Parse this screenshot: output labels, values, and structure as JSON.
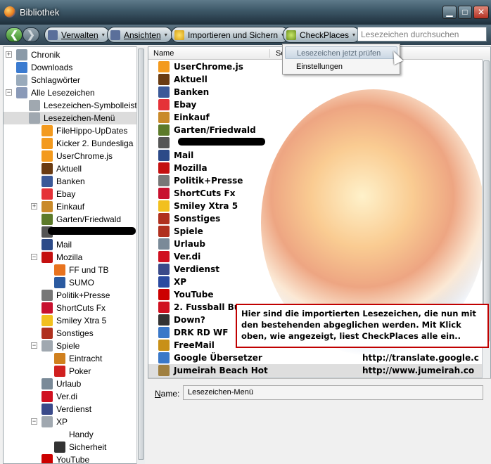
{
  "window": {
    "title": "Bibliothek",
    "minimize": "▁",
    "maximize": "□",
    "close": "✕"
  },
  "toolbar": {
    "back_glyph": "❮",
    "forward_glyph": "❯",
    "verwalten": "Verwalten",
    "ansichten": "Ansichten",
    "importieren": "Importieren und Sichern",
    "checkplaces": "CheckPlaces",
    "dropdown_glyph": "▾",
    "search_placeholder": "Lesezeichen durchsuchen"
  },
  "dropdown": {
    "items": [
      "Lesezeichen jetzt prüfen",
      "Einstellungen"
    ]
  },
  "tree": [
    {
      "label": "Chronik",
      "icon": "clock-icon",
      "color": "#8a9aa8"
    },
    {
      "label": "Downloads",
      "icon": "download-arrow-icon",
      "color": "#3b7bd0"
    },
    {
      "label": "Schlagwörter",
      "icon": "tag-icon",
      "color": "#9ab"
    },
    {
      "label": "Alle Lesezeichen",
      "icon": "bookmark-star-icon",
      "color": "#8a9ab8"
    },
    {
      "label": "Lesezeichen-Symbolleiste",
      "icon": "toolbar-folder-icon",
      "color": "#a0a8b0"
    },
    {
      "label": "Lesezeichen-Menü",
      "icon": "menu-folder-icon",
      "color": "#a0a8b0"
    },
    {
      "label": "FileHippo-UpDates",
      "icon": "rss-feed-icon",
      "color": "#f39a1e"
    },
    {
      "label": "Kicker 2. Bundesliga",
      "icon": "rss-feed-icon",
      "color": "#f39a1e"
    },
    {
      "label": "UserChrome.js",
      "icon": "rss-feed-icon",
      "color": "#f39a1e"
    },
    {
      "label": "Aktuell",
      "icon": "torch-icon",
      "color": "#6a3b12"
    },
    {
      "label": "Banken",
      "icon": "facebook-icon",
      "color": "#3b5998"
    },
    {
      "label": "Ebay",
      "icon": "ebay-icon",
      "color": "#e53238"
    },
    {
      "label": "Einkauf",
      "icon": "coin-icon",
      "color": "#c98a2a"
    },
    {
      "label": "Garten/Friedwald",
      "icon": "tree-icon",
      "color": "#5c7a2a"
    },
    {
      "label": "",
      "icon": "anonymous-icon",
      "color": "#555"
    },
    {
      "label": "Mail",
      "icon": "mail-icon",
      "color": "#2c4a88"
    },
    {
      "label": "Mozilla",
      "icon": "mozilla-icon",
      "color": "#c41010"
    },
    {
      "label": "FF und TB",
      "icon": "firefox-icon",
      "color": "#e8731f"
    },
    {
      "label": "SUMO",
      "icon": "sumo-icon",
      "color": "#2b5aa0"
    },
    {
      "label": "Politik+Presse",
      "icon": "newspaper-icon",
      "color": "#777"
    },
    {
      "label": "ShortCuts Fx",
      "icon": "flag-icon",
      "color": "#c8102e"
    },
    {
      "label": "Smiley Xtra 5",
      "icon": "smiley-icon",
      "color": "#f2c01e"
    },
    {
      "label": "Sonstiges",
      "icon": "gift-icon",
      "color": "#b0301e"
    },
    {
      "label": "Spiele",
      "icon": "game-folder-icon",
      "color": "#a0a8b0"
    },
    {
      "label": "Eintracht",
      "icon": "diamond-icon",
      "color": "#d0801e"
    },
    {
      "label": "Poker",
      "icon": "poker-icon",
      "color": "#d02020"
    },
    {
      "label": "Urlaub",
      "icon": "plane-icon",
      "color": "#7a8a98"
    },
    {
      "label": "Ver.di",
      "icon": "verdi-icon",
      "color": "#d01020"
    },
    {
      "label": "Verdienst",
      "icon": "money-icon",
      "color": "#3a4a8a"
    },
    {
      "label": "XP",
      "icon": "xp-folder-icon",
      "color": "#a0a8b0"
    },
    {
      "label": "Handy",
      "icon": "phone-icon",
      "color": "#fff"
    },
    {
      "label": "Sicherheit",
      "icon": "security-icon",
      "color": "#333"
    },
    {
      "label": "YouTube",
      "icon": "youtube-icon",
      "color": "#c00"
    }
  ],
  "columns": {
    "name": "Name",
    "location": "So"
  },
  "list": [
    {
      "label": "UserChrome.js",
      "icon": "rss-feed-icon",
      "color": "#f39a1e",
      "url": ""
    },
    {
      "label": "Aktuell",
      "icon": "torch-icon",
      "color": "#6a3b12",
      "url": ""
    },
    {
      "label": "Banken",
      "icon": "facebook-icon",
      "color": "#3b5998",
      "url": ""
    },
    {
      "label": "Ebay",
      "icon": "ebay-icon",
      "color": "#e53238",
      "url": ""
    },
    {
      "label": "Einkauf",
      "icon": "coin-icon",
      "color": "#c98a2a",
      "url": ""
    },
    {
      "label": "Garten/Friedwald",
      "icon": "tree-icon",
      "color": "#5c7a2a",
      "url": ""
    },
    {
      "label": "",
      "icon": "anonymous-icon",
      "color": "#555",
      "url": ""
    },
    {
      "label": "Mail",
      "icon": "mail-icon",
      "color": "#2c4a88",
      "url": ""
    },
    {
      "label": "Mozilla",
      "icon": "mozilla-icon",
      "color": "#c41010",
      "url": ""
    },
    {
      "label": "Politik+Presse",
      "icon": "newspaper-icon",
      "color": "#777",
      "url": ""
    },
    {
      "label": "ShortCuts Fx",
      "icon": "flag-icon",
      "color": "#c8102e",
      "url": ""
    },
    {
      "label": "Smiley Xtra 5",
      "icon": "smiley-icon",
      "color": "#f2c01e",
      "url": ""
    },
    {
      "label": "Sonstiges",
      "icon": "gift-icon",
      "color": "#b0301e",
      "url": ""
    },
    {
      "label": "Spiele",
      "icon": "game-icon",
      "color": "#b0301e",
      "url": ""
    },
    {
      "label": "Urlaub",
      "icon": "plane-icon",
      "color": "#7a8a98",
      "url": ""
    },
    {
      "label": "Ver.di",
      "icon": "verdi-icon",
      "color": "#d01020",
      "url": ""
    },
    {
      "label": "Verdienst",
      "icon": "money-icon",
      "color": "#3a4a8a",
      "url": ""
    },
    {
      "label": "XP",
      "icon": "xp-icon",
      "color": "#2a4aa0",
      "url": ""
    },
    {
      "label": "YouTube",
      "icon": "youtube-icon",
      "color": "#c00",
      "url": ""
    },
    {
      "label": "2. Fussball Bu",
      "icon": "kicker-icon",
      "color": "#d01020",
      "url": ""
    },
    {
      "label": "Down?",
      "icon": "alert-icon",
      "color": "#333",
      "url": ""
    },
    {
      "label": "DRK RD WF",
      "icon": "grid-icon",
      "color": "#3a78c8",
      "url": ""
    },
    {
      "label": "FreeMail",
      "icon": "bank-icon",
      "color": "#c89018",
      "url": ""
    },
    {
      "label": "Google Übersetzer",
      "icon": "globe-icon",
      "color": "#3a78c8",
      "url": "http://translate.google.c"
    },
    {
      "label": "Jumeirah Beach Hot",
      "icon": "pen-icon",
      "color": "#a08040",
      "url": "http://www.jumeirah.co"
    }
  ],
  "detail": {
    "name_label_prefix": "N",
    "name_label_rest": "ame:",
    "name_value": "Lesezeichen-Menü"
  },
  "annotation": "Hier sind die importierten Lesezeichen, die nun mit den bestehenden abgeglichen werden. Mit Klick oben, wie angezeigt, liest CheckPlaces alle ein.."
}
